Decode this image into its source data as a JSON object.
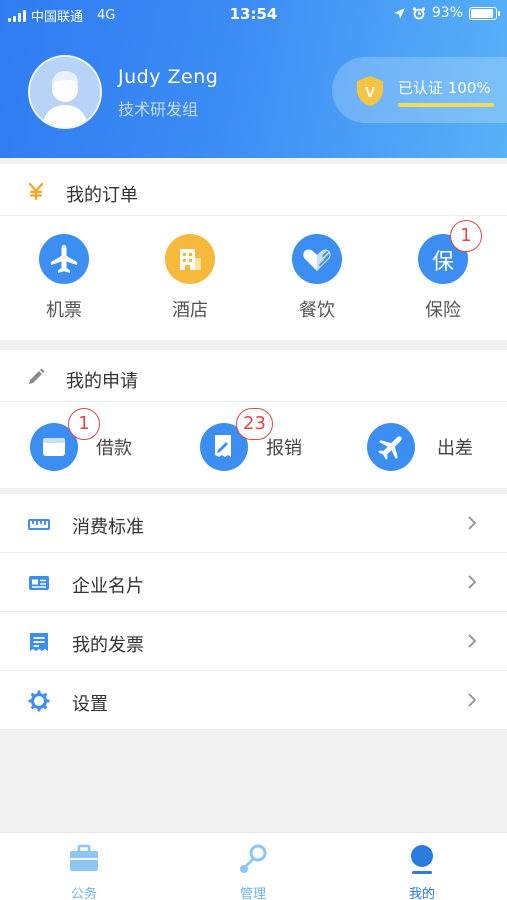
{
  "status_bar": {
    "carrier": "中国联通",
    "network": "4G",
    "time": "13:54",
    "battery": "93%",
    "battery_level": 0.93
  },
  "profile": {
    "name": "Judy Zeng",
    "department": "技术研发组",
    "cert_label": "已认证 100%",
    "cert_badge": "V",
    "cert_progress": 1.0
  },
  "orders": {
    "title": "我的订单",
    "items": [
      {
        "label": "机票",
        "icon": "airplane-icon",
        "color": "#3d8ef2",
        "badge": ""
      },
      {
        "label": "酒店",
        "icon": "hotel-icon",
        "color": "#f6b93b",
        "badge": ""
      },
      {
        "label": "餐饮",
        "icon": "dining-icon",
        "color": "#3d8ef2",
        "badge": ""
      },
      {
        "label": "保险",
        "icon": "insurance-icon",
        "color": "#3d8ef2",
        "badge": "1",
        "glyph": "保"
      }
    ]
  },
  "applications": {
    "title": "我的申请",
    "items": [
      {
        "label": "借款",
        "icon": "wallet-icon",
        "badge": "1"
      },
      {
        "label": "报销",
        "icon": "receipt-icon",
        "badge": "23"
      },
      {
        "label": "出差",
        "icon": "airplane-icon",
        "badge": ""
      }
    ]
  },
  "menu": [
    {
      "label": "消费标准",
      "icon": "ruler-icon"
    },
    {
      "label": "企业名片",
      "icon": "business-card-icon"
    },
    {
      "label": "我的发票",
      "icon": "invoice-icon"
    },
    {
      "label": "设置",
      "icon": "gear-icon"
    }
  ],
  "tabs": [
    {
      "label": "公务",
      "icon": "briefcase-icon",
      "active": false
    },
    {
      "label": "管理",
      "icon": "management-icon",
      "active": false
    },
    {
      "label": "我的",
      "icon": "person-icon",
      "active": true
    }
  ],
  "colors": {
    "brand": "#3d8ef2",
    "accent_yellow": "#f6b93b",
    "badge": "#e3464a",
    "tab_active": "#2b7be0",
    "tab_inactive": "#6fb4ee"
  }
}
